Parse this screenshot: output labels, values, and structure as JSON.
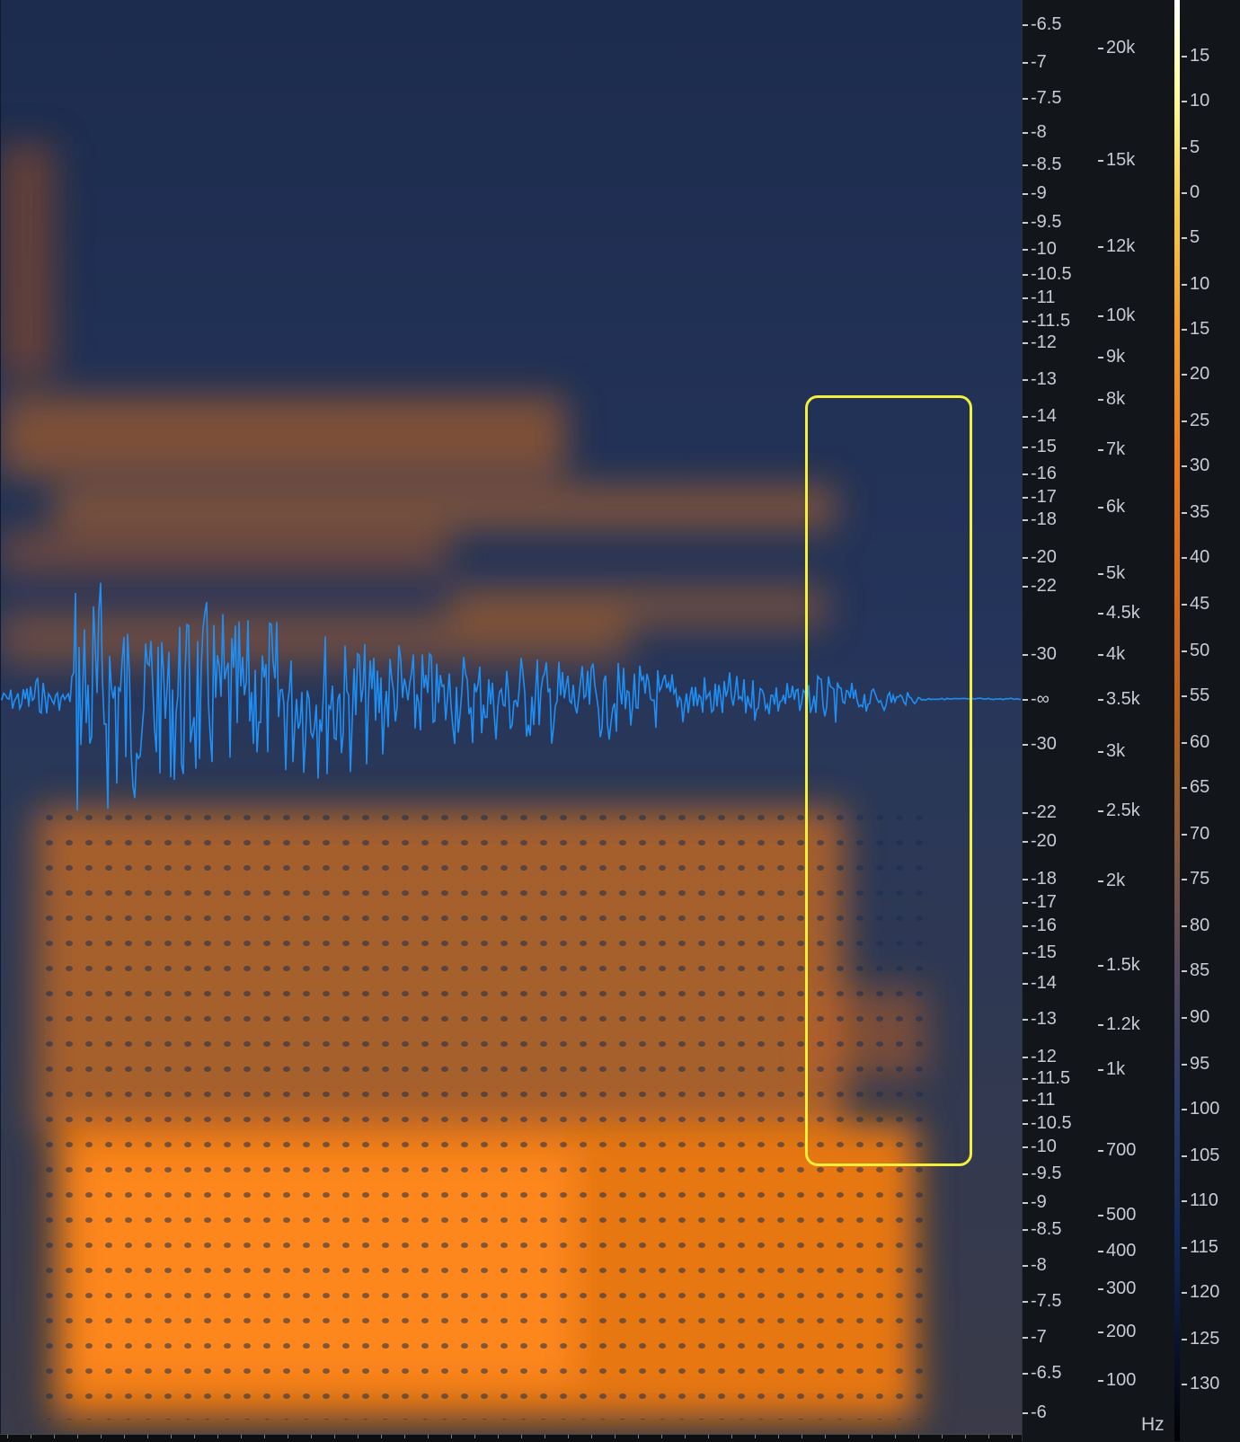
{
  "spectrogram": {
    "colors": {
      "background": "#1a2a4a",
      "energy": "#ff7a10",
      "waveform": "#1e8ff5",
      "selection": "#f2f03a"
    }
  },
  "db_scale": {
    "labels": [
      "-6.5",
      "-7",
      "-7.5",
      "-8",
      "-8.5",
      "-9",
      "-9.5",
      "-10",
      "-10.5",
      "-11",
      "-11.5",
      "-12",
      "-13",
      "-14",
      "-15",
      "-16",
      "-17",
      "-18",
      "-20",
      "-22",
      "-30",
      "-∞",
      "-30",
      "-22",
      "-20",
      "-18",
      "-17",
      "-16",
      "-15",
      "-14",
      "-13",
      "-12",
      "-11.5",
      "-11",
      "-10.5",
      "-10",
      "-9.5",
      "-9",
      "-8.5",
      "-8",
      "-7.5",
      "-7",
      "-6.5",
      "-6"
    ]
  },
  "hz_scale": {
    "labels": [
      "20k",
      "15k",
      "12k",
      "10k",
      "9k",
      "8k",
      "7k",
      "6k",
      "5k",
      "4.5k",
      "4k",
      "3.5k",
      "3k",
      "2.5k",
      "2k",
      "1.5k",
      "1.2k",
      "1k",
      "700",
      "500",
      "400",
      "300",
      "200",
      "100"
    ],
    "unit": "Hz"
  },
  "level_scale": {
    "labels": [
      "15",
      "10",
      "5",
      "0",
      "5",
      "10",
      "15",
      "20",
      "25",
      "30",
      "35",
      "40",
      "45",
      "50",
      "55",
      "60",
      "65",
      "70",
      "75",
      "80",
      "85",
      "90",
      "95",
      "100",
      "105",
      "110",
      "115",
      "120",
      "125",
      "130"
    ]
  }
}
